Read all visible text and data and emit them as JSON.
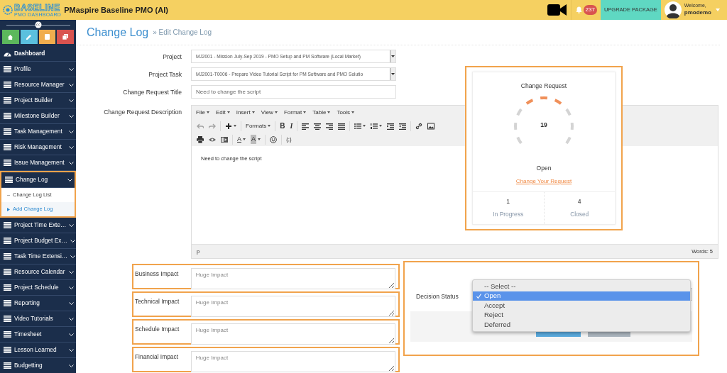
{
  "header": {
    "logo": {
      "name": "BASELINE",
      "tagline": "PMO DASHBOARD"
    },
    "title": "PMaspire Baseline PMO (AI)",
    "notifications": "237",
    "upgrade_button": "UPGRADE PACKAGE",
    "user": {
      "greeting": "Welcome,",
      "name": "pmodemo"
    }
  },
  "sidebar": {
    "items": [
      {
        "label": "Dashboard",
        "kind": "link",
        "expanded": false
      },
      {
        "label": "Profile",
        "kind": "menu",
        "expanded": false
      },
      {
        "label": "Resource Manager",
        "kind": "menu",
        "expanded": false
      },
      {
        "label": "Project Builder",
        "kind": "menu",
        "expanded": false
      },
      {
        "label": "Milestone Builder",
        "kind": "menu",
        "expanded": false
      },
      {
        "label": "Task Management",
        "kind": "menu",
        "expanded": false
      },
      {
        "label": "Risk Management",
        "kind": "menu",
        "expanded": false
      },
      {
        "label": "Issue Management",
        "kind": "menu",
        "expanded": false
      },
      {
        "label": "Change Log",
        "kind": "menu",
        "expanded": true,
        "children": [
          {
            "label": "Change Log List",
            "selected": false
          },
          {
            "label": "Add Change Log",
            "selected": true
          }
        ]
      },
      {
        "label": "Project Time Exte…",
        "kind": "menu",
        "expanded": false
      },
      {
        "label": "Project Budget Ex…",
        "kind": "menu",
        "expanded": false
      },
      {
        "label": "Task Time Extensi…",
        "kind": "menu",
        "expanded": false
      },
      {
        "label": "Resource Calendar",
        "kind": "menu",
        "expanded": false
      },
      {
        "label": "Project Schedule",
        "kind": "menu",
        "expanded": false
      },
      {
        "label": "Reporting",
        "kind": "menu",
        "expanded": false
      },
      {
        "label": "Video Tutorials",
        "kind": "menu",
        "expanded": false
      },
      {
        "label": "Timesheet",
        "kind": "menu",
        "expanded": false
      },
      {
        "label": "Lesson Learned",
        "kind": "menu",
        "expanded": false
      },
      {
        "label": "Budgetting",
        "kind": "menu",
        "expanded": false
      }
    ]
  },
  "page": {
    "title": "Change Log",
    "breadcrumb": "» Edit Change Log"
  },
  "form": {
    "fields": [
      {
        "label": "Project",
        "kind": "select",
        "value": "MJ2001 - Mission July-Sep 2019 - PMO Setup and PM Software (Local Market)"
      },
      {
        "label": "Project Task",
        "kind": "select",
        "value": "MJ2001-T0006 - Prepare Video Tutorial Script for PM Software and PMO Solutio"
      },
      {
        "label": "Change Request Title",
        "kind": "text",
        "value": "Need to change the script"
      }
    ],
    "description": {
      "label": "Change Request Description",
      "menus": [
        "File",
        "Edit",
        "Insert",
        "View",
        "Format",
        "Table",
        "Tools"
      ],
      "toolbar": [
        [
          {
            "kind": "undo",
            "disabled": true
          },
          {
            "kind": "redo",
            "disabled": true
          },
          {
            "kind": "sep"
          },
          {
            "kind": "insert",
            "disabled": false
          },
          {
            "kind": "sep"
          },
          {
            "kind": "formats",
            "label": "Formats",
            "disabled": false
          },
          {
            "kind": "sep"
          },
          {
            "kind": "bold",
            "label": "B",
            "disabled": false
          },
          {
            "kind": "italic",
            "label": "I",
            "disabled": false
          },
          {
            "kind": "sep"
          },
          {
            "kind": "alignleft",
            "disabled": false
          },
          {
            "kind": "aligncenter",
            "disabled": false
          },
          {
            "kind": "alignright",
            "disabled": false
          },
          {
            "kind": "alignjustify",
            "disabled": false
          },
          {
            "kind": "sep"
          },
          {
            "kind": "bullist",
            "disabled": false
          },
          {
            "kind": "numlist",
            "disabled": false
          },
          {
            "kind": "outdent",
            "disabled": false
          },
          {
            "kind": "indent",
            "disabled": false
          },
          {
            "kind": "sep"
          },
          {
            "kind": "link",
            "disabled": false
          },
          {
            "kind": "image",
            "disabled": false
          }
        ],
        [
          {
            "kind": "print",
            "disabled": false
          },
          {
            "kind": "preview",
            "disabled": false
          },
          {
            "kind": "media",
            "disabled": false
          },
          {
            "kind": "sep"
          },
          {
            "kind": "forecolor",
            "label": "A",
            "disabled": false
          },
          {
            "kind": "backcolor",
            "label": "A",
            "disabled": false
          },
          {
            "kind": "sep"
          },
          {
            "kind": "emoticons",
            "disabled": false
          },
          {
            "kind": "sep"
          },
          {
            "kind": "code",
            "label": "{;}",
            "disabled": false
          }
        ]
      ],
      "body": "Need to change the script",
      "path": "p",
      "word_count": "Words: 5"
    }
  },
  "card": {
    "title": "Change Request",
    "gauge": {
      "count": "19"
    },
    "status": "Open",
    "link": "Change Your Request",
    "stats": [
      {
        "value": "1",
        "label": "In Progress"
      },
      {
        "value": "4",
        "label": "Closed"
      }
    ]
  },
  "impacts": [
    {
      "label": "Business Impact",
      "placeholder": "Huge Impact"
    },
    {
      "label": "Technical Impact",
      "placeholder": "Huge Impact"
    },
    {
      "label": "Schedule Impact",
      "placeholder": "Huge Impact"
    },
    {
      "label": "Financial Impact",
      "placeholder": "Huge Impact"
    }
  ],
  "decision": {
    "label": "Decision Status",
    "options": [
      {
        "label": "-- Select --",
        "selected": false
      },
      {
        "label": "Open",
        "selected": true
      },
      {
        "label": "Accept",
        "selected": false
      },
      {
        "label": "Reject",
        "selected": false
      },
      {
        "label": "Deferred",
        "selected": false
      }
    ]
  }
}
